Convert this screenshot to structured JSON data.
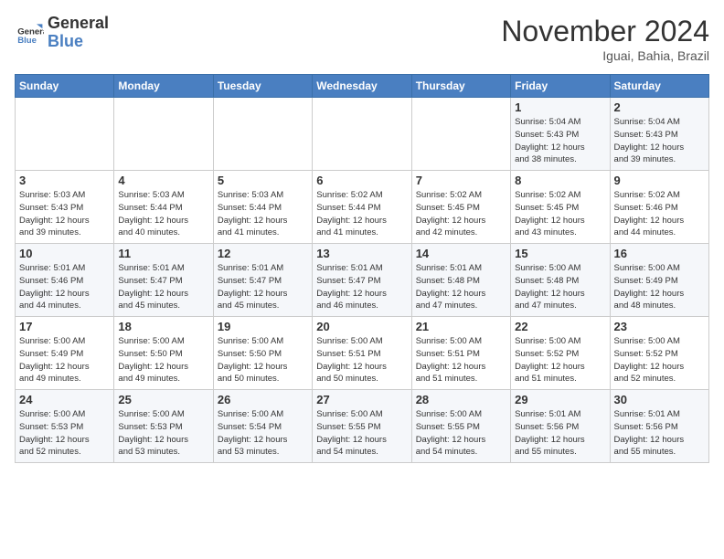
{
  "header": {
    "logo_general": "General",
    "logo_blue": "Blue",
    "month_title": "November 2024",
    "location": "Iguai, Bahia, Brazil"
  },
  "weekdays": [
    "Sunday",
    "Monday",
    "Tuesday",
    "Wednesday",
    "Thursday",
    "Friday",
    "Saturday"
  ],
  "weeks": [
    [
      {
        "day": "",
        "info": ""
      },
      {
        "day": "",
        "info": ""
      },
      {
        "day": "",
        "info": ""
      },
      {
        "day": "",
        "info": ""
      },
      {
        "day": "",
        "info": ""
      },
      {
        "day": "1",
        "info": "Sunrise: 5:04 AM\nSunset: 5:43 PM\nDaylight: 12 hours\nand 38 minutes."
      },
      {
        "day": "2",
        "info": "Sunrise: 5:04 AM\nSunset: 5:43 PM\nDaylight: 12 hours\nand 39 minutes."
      }
    ],
    [
      {
        "day": "3",
        "info": "Sunrise: 5:03 AM\nSunset: 5:43 PM\nDaylight: 12 hours\nand 39 minutes."
      },
      {
        "day": "4",
        "info": "Sunrise: 5:03 AM\nSunset: 5:44 PM\nDaylight: 12 hours\nand 40 minutes."
      },
      {
        "day": "5",
        "info": "Sunrise: 5:03 AM\nSunset: 5:44 PM\nDaylight: 12 hours\nand 41 minutes."
      },
      {
        "day": "6",
        "info": "Sunrise: 5:02 AM\nSunset: 5:44 PM\nDaylight: 12 hours\nand 41 minutes."
      },
      {
        "day": "7",
        "info": "Sunrise: 5:02 AM\nSunset: 5:45 PM\nDaylight: 12 hours\nand 42 minutes."
      },
      {
        "day": "8",
        "info": "Sunrise: 5:02 AM\nSunset: 5:45 PM\nDaylight: 12 hours\nand 43 minutes."
      },
      {
        "day": "9",
        "info": "Sunrise: 5:02 AM\nSunset: 5:46 PM\nDaylight: 12 hours\nand 44 minutes."
      }
    ],
    [
      {
        "day": "10",
        "info": "Sunrise: 5:01 AM\nSunset: 5:46 PM\nDaylight: 12 hours\nand 44 minutes."
      },
      {
        "day": "11",
        "info": "Sunrise: 5:01 AM\nSunset: 5:47 PM\nDaylight: 12 hours\nand 45 minutes."
      },
      {
        "day": "12",
        "info": "Sunrise: 5:01 AM\nSunset: 5:47 PM\nDaylight: 12 hours\nand 45 minutes."
      },
      {
        "day": "13",
        "info": "Sunrise: 5:01 AM\nSunset: 5:47 PM\nDaylight: 12 hours\nand 46 minutes."
      },
      {
        "day": "14",
        "info": "Sunrise: 5:01 AM\nSunset: 5:48 PM\nDaylight: 12 hours\nand 47 minutes."
      },
      {
        "day": "15",
        "info": "Sunrise: 5:00 AM\nSunset: 5:48 PM\nDaylight: 12 hours\nand 47 minutes."
      },
      {
        "day": "16",
        "info": "Sunrise: 5:00 AM\nSunset: 5:49 PM\nDaylight: 12 hours\nand 48 minutes."
      }
    ],
    [
      {
        "day": "17",
        "info": "Sunrise: 5:00 AM\nSunset: 5:49 PM\nDaylight: 12 hours\nand 49 minutes."
      },
      {
        "day": "18",
        "info": "Sunrise: 5:00 AM\nSunset: 5:50 PM\nDaylight: 12 hours\nand 49 minutes."
      },
      {
        "day": "19",
        "info": "Sunrise: 5:00 AM\nSunset: 5:50 PM\nDaylight: 12 hours\nand 50 minutes."
      },
      {
        "day": "20",
        "info": "Sunrise: 5:00 AM\nSunset: 5:51 PM\nDaylight: 12 hours\nand 50 minutes."
      },
      {
        "day": "21",
        "info": "Sunrise: 5:00 AM\nSunset: 5:51 PM\nDaylight: 12 hours\nand 51 minutes."
      },
      {
        "day": "22",
        "info": "Sunrise: 5:00 AM\nSunset: 5:52 PM\nDaylight: 12 hours\nand 51 minutes."
      },
      {
        "day": "23",
        "info": "Sunrise: 5:00 AM\nSunset: 5:52 PM\nDaylight: 12 hours\nand 52 minutes."
      }
    ],
    [
      {
        "day": "24",
        "info": "Sunrise: 5:00 AM\nSunset: 5:53 PM\nDaylight: 12 hours\nand 52 minutes."
      },
      {
        "day": "25",
        "info": "Sunrise: 5:00 AM\nSunset: 5:53 PM\nDaylight: 12 hours\nand 53 minutes."
      },
      {
        "day": "26",
        "info": "Sunrise: 5:00 AM\nSunset: 5:54 PM\nDaylight: 12 hours\nand 53 minutes."
      },
      {
        "day": "27",
        "info": "Sunrise: 5:00 AM\nSunset: 5:55 PM\nDaylight: 12 hours\nand 54 minutes."
      },
      {
        "day": "28",
        "info": "Sunrise: 5:00 AM\nSunset: 5:55 PM\nDaylight: 12 hours\nand 54 minutes."
      },
      {
        "day": "29",
        "info": "Sunrise: 5:01 AM\nSunset: 5:56 PM\nDaylight: 12 hours\nand 55 minutes."
      },
      {
        "day": "30",
        "info": "Sunrise: 5:01 AM\nSunset: 5:56 PM\nDaylight: 12 hours\nand 55 minutes."
      }
    ]
  ]
}
